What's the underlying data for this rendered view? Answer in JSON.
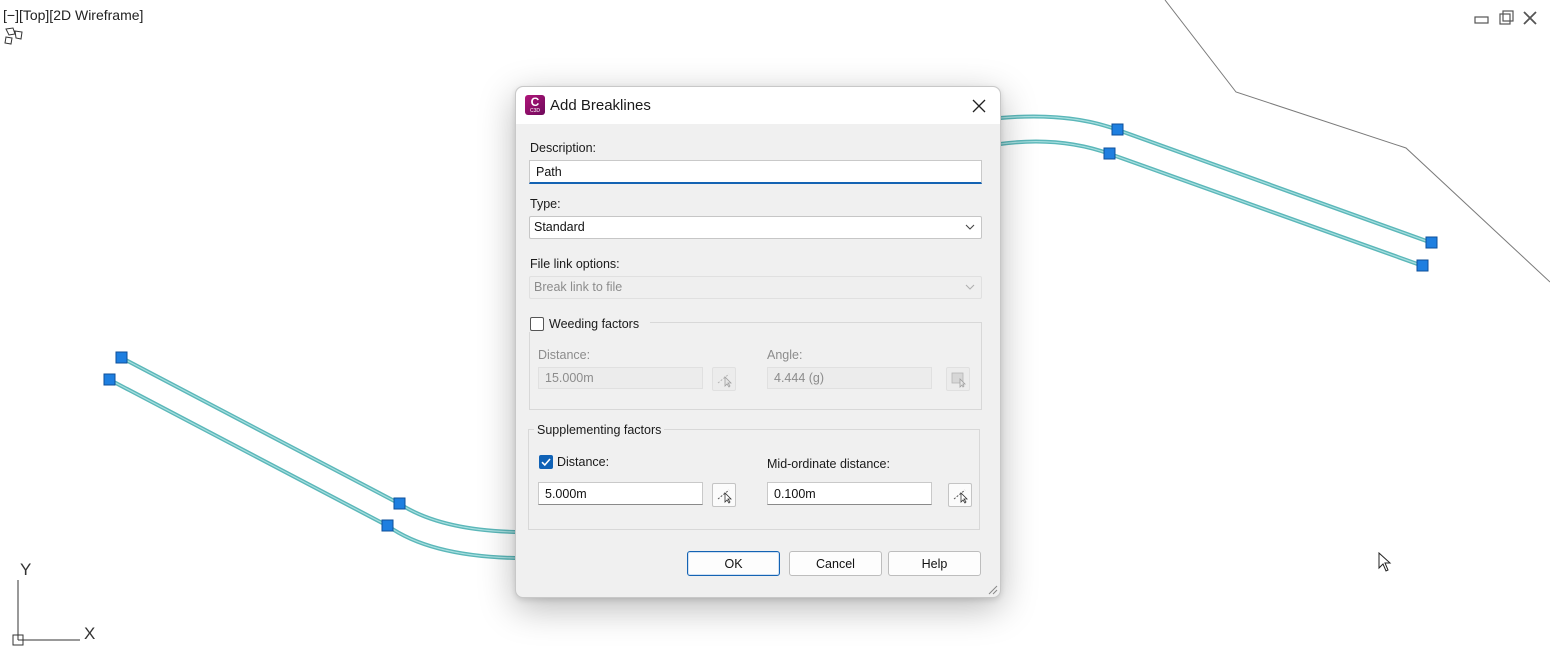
{
  "viewport": {
    "label": "[−][Top][2D Wireframe]",
    "breakline_color": "#5bb7b9",
    "grip_color": "#1e7fe0",
    "ucs_x": "X",
    "ucs_y": "Y"
  },
  "dialog": {
    "title": "Add Breaklines",
    "app_icon_letter": "C",
    "app_icon_sub": "C3D",
    "description": {
      "label": "Description:",
      "value": "Path"
    },
    "type": {
      "label": "Type:",
      "selected": "Standard"
    },
    "file_link": {
      "label": "File link options:",
      "selected": "Break link to file"
    },
    "weeding": {
      "label": "Weeding factors",
      "checked": false,
      "distance_label": "Distance:",
      "distance_value": "15.000m",
      "angle_label": "Angle:",
      "angle_value": "4.444 (g)"
    },
    "supplementing": {
      "label": "Supplementing factors",
      "distance_label": "Distance:",
      "distance_checked": true,
      "distance_value": "5.000m",
      "mid_label": "Mid-ordinate distance:",
      "mid_value": "0.100m"
    },
    "buttons": {
      "ok": "OK",
      "cancel": "Cancel",
      "help": "Help"
    },
    "accent_color": "#1463b3"
  }
}
